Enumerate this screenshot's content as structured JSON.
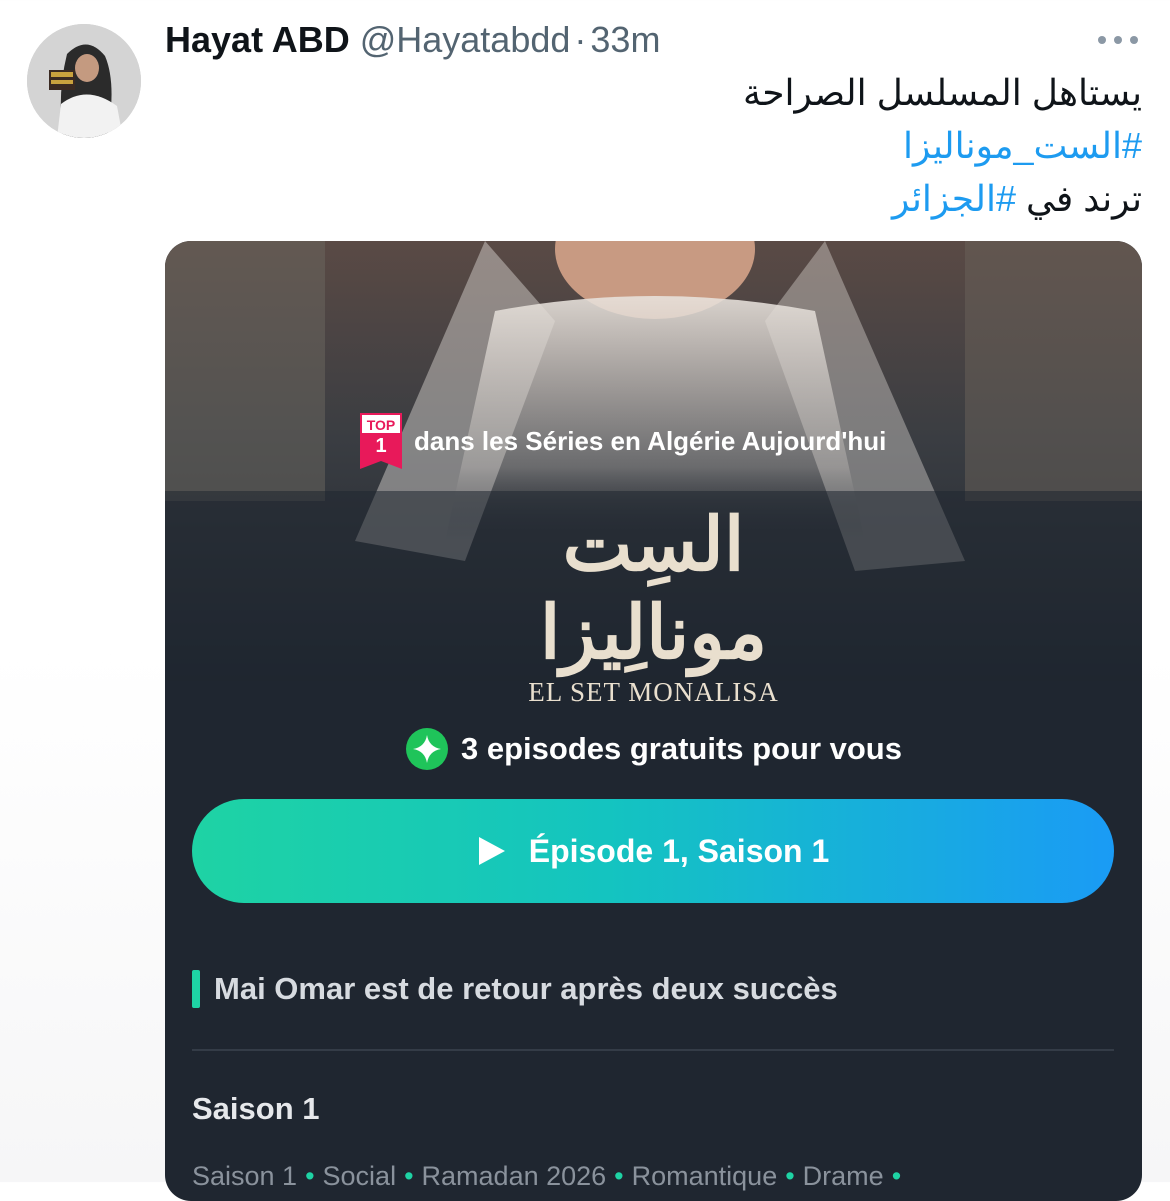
{
  "tweet": {
    "display_name": "Hayat ABD",
    "handle": "@Hayatabdd",
    "separator": "·",
    "time": "33m",
    "text_line1": "يستاهل المسلسل الصراحة",
    "hashtag_1": "#الست_موناليزا",
    "text_line3_prefix": "ترند  في ",
    "hashtag_2": "#الجزائر"
  },
  "media": {
    "badge_top": "TOP",
    "badge_rank": "1",
    "top_text": "dans les Séries en Algérie Aujourd'hui",
    "logo_ar_line1": "السِت",
    "logo_ar_line2": "مونالِيزا",
    "logo_en": "EL SET MONALISA",
    "free_episodes": "3 episodes gratuits pour vous",
    "play_label": "Épisode 1, Saison 1",
    "tagline": "Mai Omar est de retour après deux succès",
    "season_heading": "Saison 1",
    "meta_tags": [
      "Saison 1",
      "Social",
      "Ramadan 2026",
      "Romantique",
      "Drame"
    ],
    "meta_separator": "•"
  },
  "colors": {
    "hashtag": "#1d9bf0",
    "card_background": "#1f2630",
    "accent_green": "#1ed3a4",
    "accent_blue": "#1a9bf5",
    "badge_pink": "#e8195a"
  },
  "icons": {
    "more": "more-horizontal-icon",
    "badge": "top-rank-badge-icon",
    "free": "diamond-star-icon",
    "play": "play-icon"
  }
}
